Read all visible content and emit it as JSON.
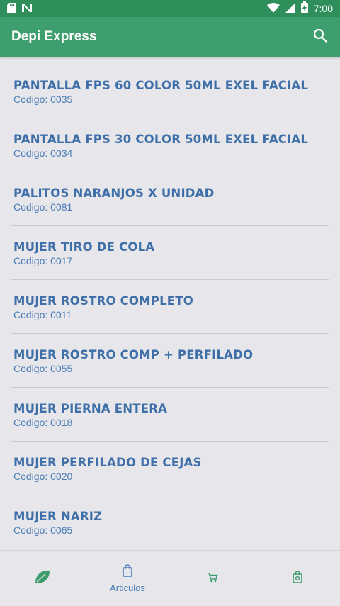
{
  "status_bar": {
    "time": "7:00",
    "left_icons": [
      "sd-card-icon",
      "n-notification-icon"
    ],
    "right_icons": [
      "wifi-icon",
      "signal-icon",
      "battery-charging-icon"
    ]
  },
  "app_bar": {
    "title": "Depi Express",
    "search_icon": "search-icon",
    "color": "#3f9e6e"
  },
  "items": [
    {
      "name": "PANTALLA FPS 60 COLOR 50ML EXEL FACIAL",
      "code": "Codigo: 0035"
    },
    {
      "name": "PANTALLA FPS 30 COLOR 50ML EXEL FACIAL",
      "code": "Codigo: 0034"
    },
    {
      "name": "PALITOS NARANJOS X UNIDAD",
      "code": "Codigo: 0081"
    },
    {
      "name": "MUJER TIRO DE COLA",
      "code": "Codigo: 0017"
    },
    {
      "name": "MUJER ROSTRO COMPLETO",
      "code": "Codigo: 0011"
    },
    {
      "name": "MUJER ROSTRO COMP + PERFILADO",
      "code": "Codigo: 0055"
    },
    {
      "name": "MUJER PIERNA ENTERA",
      "code": "Codigo: 0018"
    },
    {
      "name": "MUJER PERFILADO DE CEJAS",
      "code": "Codigo: 0020"
    },
    {
      "name": "MUJER NARIZ",
      "code": "Codigo: 0065"
    }
  ],
  "bottom_nav": {
    "items": [
      {
        "icon": "leaf-icon",
        "label": ""
      },
      {
        "icon": "shopping-bag-icon",
        "label": "Articulos"
      },
      {
        "icon": "cart-icon",
        "label": ""
      },
      {
        "icon": "bag-check-icon",
        "label": ""
      }
    ]
  },
  "colors": {
    "item_text": "#3f6fa8",
    "accent_green": "#3f9e6e",
    "background": "#e6e6eb"
  }
}
